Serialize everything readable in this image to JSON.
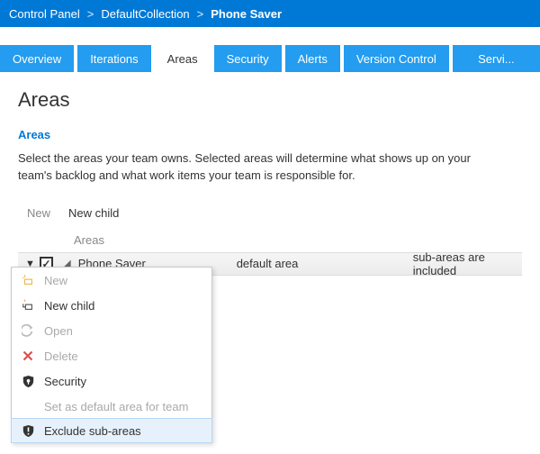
{
  "breadcrumb": {
    "root": "Control Panel",
    "collection": "DefaultCollection",
    "project": "Phone Saver"
  },
  "tabs": [
    {
      "label": "Overview"
    },
    {
      "label": "Iterations"
    },
    {
      "label": "Areas"
    },
    {
      "label": "Security"
    },
    {
      "label": "Alerts"
    },
    {
      "label": "Version Control"
    },
    {
      "label": "Servi..."
    }
  ],
  "page": {
    "title": "Areas",
    "section": "Areas",
    "description": "Select the areas your team owns. Selected areas will determine what shows up on your team's backlog and what work items your team is responsible for."
  },
  "toolbar": {
    "new": "New",
    "new_child": "New child"
  },
  "grid": {
    "header": "Areas",
    "row": {
      "checked": true,
      "name": "Phone Saver",
      "default_area": "default area",
      "sub_areas": "sub-areas are included"
    }
  },
  "context_menu": {
    "new": "New",
    "new_child": "New child",
    "open": "Open",
    "delete": "Delete",
    "security": "Security",
    "set_default": "Set as default area for team",
    "exclude": "Exclude sub-areas"
  }
}
